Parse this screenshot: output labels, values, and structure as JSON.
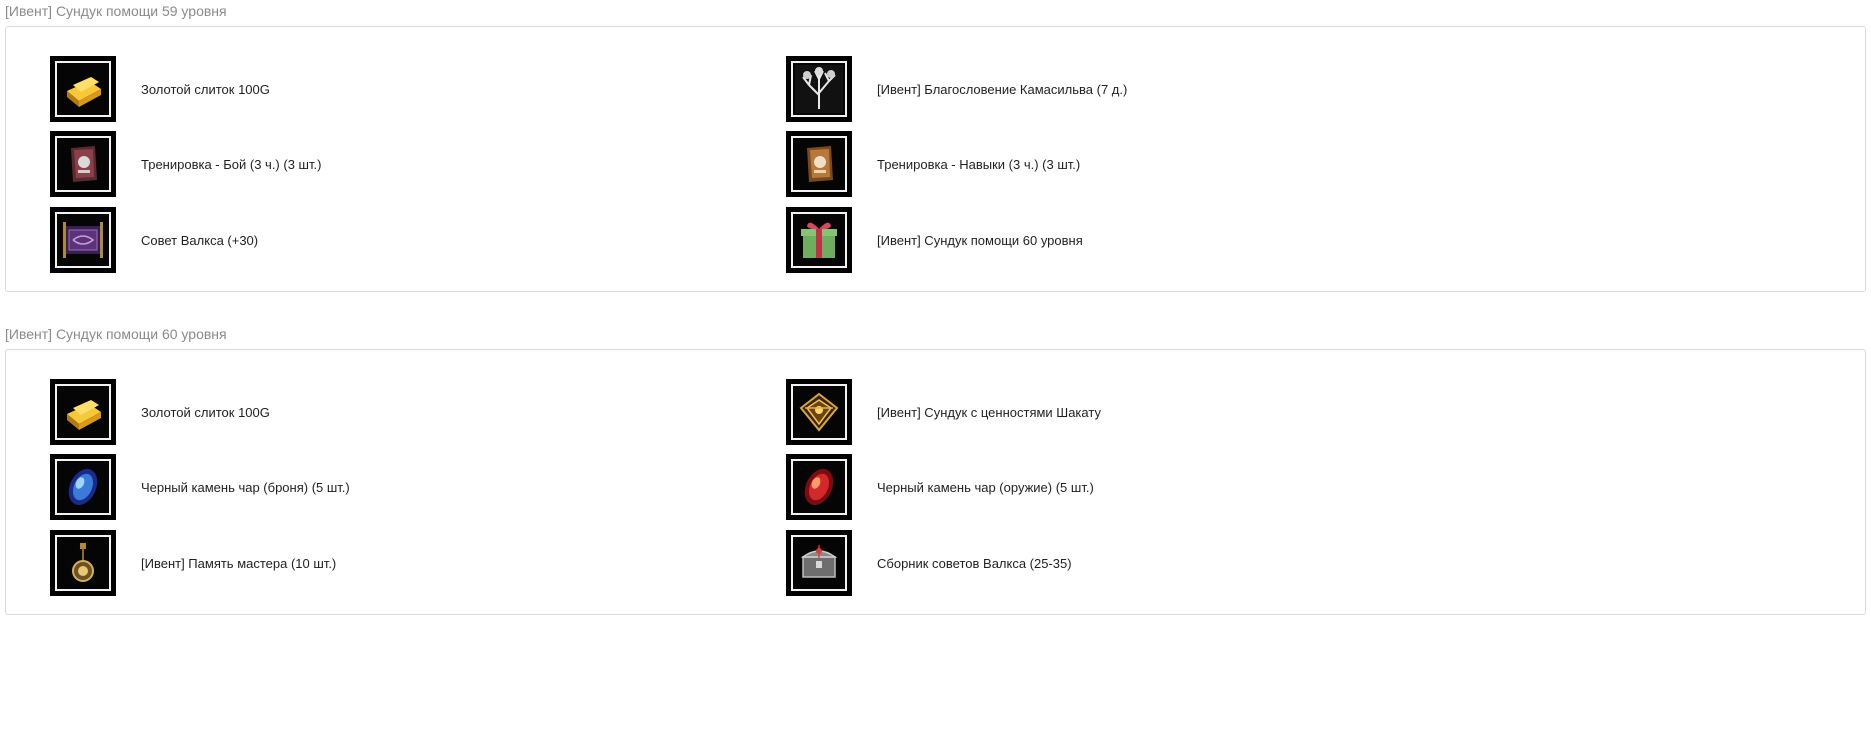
{
  "sections": [
    {
      "title": "[Ивент] Сундук помощи 59 уровня",
      "items": [
        {
          "label": "Золотой слиток 100G",
          "icon": "gold-bar-icon"
        },
        {
          "label": "[Ивент] Благословение Камасильва (7 д.)",
          "icon": "white-tree-icon"
        },
        {
          "label": "Тренировка - Бой (3 ч.) (3 шт.)",
          "icon": "combat-training-book-icon"
        },
        {
          "label": "Тренировка - Навыки (3 ч.) (3 шт.)",
          "icon": "skill-training-book-icon"
        },
        {
          "label": "Совет Валкса (+30)",
          "icon": "scroll-icon"
        },
        {
          "label": "[Ивент] Сундук помощи 60 уровня",
          "icon": "gift-box-icon"
        }
      ]
    },
    {
      "title": "[Ивент] Сундук помощи 60 уровня",
      "items": [
        {
          "label": "Золотой слиток 100G",
          "icon": "gold-bar-icon"
        },
        {
          "label": "[Ивент] Сундук с ценностями Шакату",
          "icon": "ornate-chest-icon"
        },
        {
          "label": "Черный камень чар (броня) (5 шт.)",
          "icon": "blue-stone-icon"
        },
        {
          "label": "Черный камень чар (оружие) (5 шт.)",
          "icon": "red-stone-icon"
        },
        {
          "label": "[Ивент] Память мастера (10 шт.)",
          "icon": "pendant-icon"
        },
        {
          "label": "Сборник советов Валкса (25-35)",
          "icon": "silver-chest-icon"
        }
      ]
    }
  ]
}
